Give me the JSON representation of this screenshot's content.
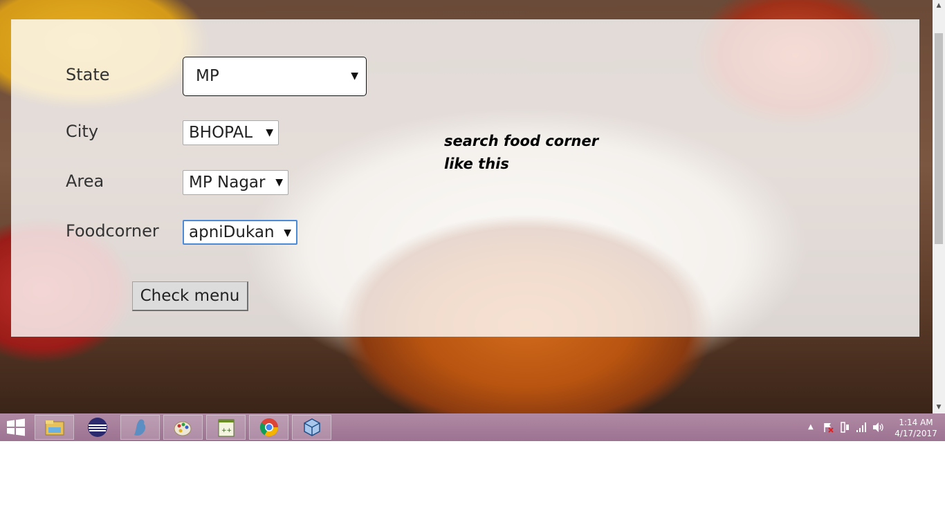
{
  "form": {
    "state": {
      "label": "State",
      "value": "MP"
    },
    "city": {
      "label": "City",
      "value": "BHOPAL"
    },
    "area": {
      "label": "Area",
      "value": "MP Nagar"
    },
    "foodcorner": {
      "label": "Foodcorner",
      "value": "apniDukan"
    },
    "submit_label": "Check menu",
    "dropdown_arrow": "▼"
  },
  "annotation": {
    "line1": "search food corner",
    "line2": "like this"
  },
  "taskbar": {
    "apps": [
      "start-icon",
      "file-explorer-icon",
      "eclipse-icon",
      "mysql-icon",
      "paint-icon",
      "notepad-plus-plus-icon",
      "chrome-icon",
      "virtualbox-icon"
    ],
    "time": "1:14 AM",
    "date": "4/17/2017"
  },
  "colors": {
    "focus_border": "#4b8ad6",
    "taskbar": "#a47f9a"
  }
}
